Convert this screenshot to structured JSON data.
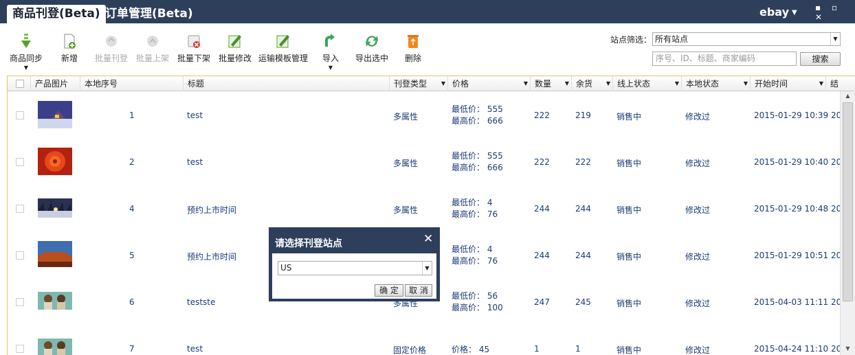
{
  "tabs": [
    {
      "label": "商品刊登(Beta)",
      "active": true
    },
    {
      "label": "订单管理(Beta)",
      "active": false
    }
  ],
  "account_menu": {
    "label": "ebay"
  },
  "window_buttons": {
    "label": "▪ ▫ ✕"
  },
  "toolbar": {
    "items": [
      {
        "label": "商品同步",
        "icon": "sync-icon",
        "enabled": true,
        "has_dropdown": true
      },
      {
        "label": "新增",
        "icon": "new-document-icon",
        "enabled": true
      },
      {
        "label": "批量刊登",
        "icon": "batch-publish-icon",
        "enabled": false
      },
      {
        "label": "批量上架",
        "icon": "batch-shelve-icon",
        "enabled": false
      },
      {
        "label": "批量下架",
        "icon": "batch-unshelve-icon",
        "enabled": true
      },
      {
        "label": "批量修改",
        "icon": "batch-edit-icon",
        "enabled": true
      },
      {
        "label": "运输模板管理",
        "icon": "shipping-template-icon",
        "enabled": true
      },
      {
        "label": "导入",
        "icon": "import-icon",
        "enabled": true,
        "has_dropdown": true
      },
      {
        "label": "导出选中",
        "icon": "export-icon",
        "enabled": true
      },
      {
        "label": "删除",
        "icon": "delete-icon",
        "enabled": true
      }
    ],
    "site_filter_label": "站点筛选：",
    "site_filter_value": "所有站点",
    "search_placeholder": "序号、ID、标题、商家编码",
    "search_button": "搜索"
  },
  "table": {
    "columns": [
      "产品图片",
      "本地序号",
      "标题",
      "刊登类型",
      "价格",
      "数量",
      "余货",
      "线上状态",
      "本地状态",
      "开始时间",
      "结"
    ],
    "rows": [
      {
        "index": "1",
        "title": "test",
        "type": "多属性",
        "price": [
          "最低价： 555",
          "最高价： 666"
        ],
        "qty": "222",
        "stock": "219",
        "online": "销售中",
        "local": "修改过",
        "start": "2015-01-29 10:39",
        "end": "20"
      },
      {
        "index": "2",
        "title": "test",
        "type": "多属性",
        "price": [
          "最低价： 555",
          "最高价： 666"
        ],
        "qty": "222",
        "stock": "222",
        "online": "销售中",
        "local": "修改过",
        "start": "2015-01-29 10:40",
        "end": "20"
      },
      {
        "index": "4",
        "title": "预约上市时间",
        "type": "多属性",
        "price": [
          "最低价： 4",
          "最高价： 76"
        ],
        "qty": "244",
        "stock": "244",
        "online": "销售中",
        "local": "修改过",
        "start": "2015-01-29 10:48",
        "end": "20"
      },
      {
        "index": "5",
        "title": "预约上市时间",
        "type": "",
        "price": [
          "最低价： 4",
          "最高价： 76"
        ],
        "qty": "244",
        "stock": "244",
        "online": "销售中",
        "local": "修改过",
        "start": "2015-01-29 10:51",
        "end": "20"
      },
      {
        "index": "6",
        "title": "testste",
        "type": "多属性",
        "price": [
          "最低价： 56",
          "最高价： 100"
        ],
        "qty": "247",
        "stock": "245",
        "online": "销售中",
        "local": "修改过",
        "start": "2015-04-03 11:11",
        "end": "20"
      },
      {
        "index": "7",
        "title": "test",
        "type": "固定价格",
        "price": [
          "价格： 45"
        ],
        "qty": "1",
        "stock": "1",
        "online": "销售中",
        "local": "修改过",
        "start": "2015-04-24 11:10",
        "end": "20"
      }
    ]
  },
  "dialog": {
    "title": "请选择刊登站点",
    "close": "✕",
    "site_value": "US",
    "ok": "确 定",
    "cancel": "取 消"
  }
}
